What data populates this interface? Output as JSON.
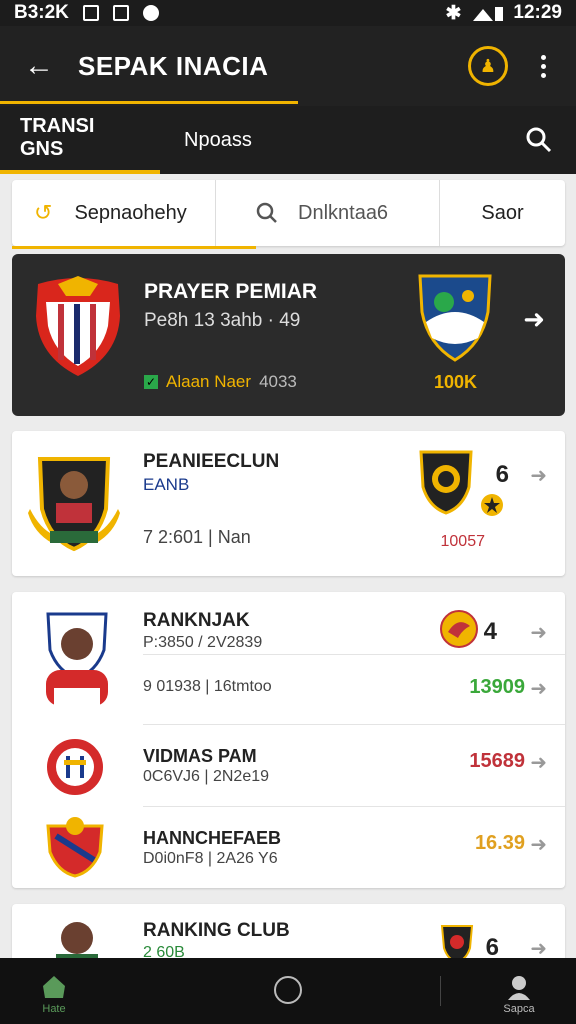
{
  "status_bar": {
    "left_text": "B3:2K",
    "time": "12:29"
  },
  "app_bar": {
    "title": "SEPAK INACIA"
  },
  "tabs": [
    {
      "label": "TRANSI GNS"
    },
    {
      "label": "Npoass"
    }
  ],
  "filters": {
    "first": "Sepnaohehy",
    "second": "Dnlkntaa6",
    "third": "Saor"
  },
  "featured": {
    "name": "PRAYER PEMIAR",
    "sub": "Pe8h 13 3ahb · 49",
    "meta_label": "Alaan Naer",
    "meta_number": "4033",
    "score": "100K"
  },
  "cards": [
    {
      "title": "PEANIEECLUN",
      "sub": "EANB",
      "meta": "7  2:601 | Nan",
      "val_top": "6",
      "val_bottom": "10057",
      "val_color": "#c0323a"
    },
    {
      "title": "RANKNJAK",
      "sub": "P:3850  / 2V2839",
      "meta": "9 01938 | 16tmtoo",
      "val_top": "4",
      "val": "13909",
      "val_color": "#3aa83a"
    },
    {
      "title": "VIDMAS PAM",
      "sub": "0C6VJ6  | 2N2e19",
      "val": "15689",
      "val_color": "#c0323a"
    },
    {
      "title": "HANNCHEFAEB",
      "sub": "D0i0nF8 | 2A26 Y6",
      "val": "16.39",
      "val_color": "#e0a020"
    }
  ],
  "last_card": {
    "title": "RANKING CLUB",
    "sub": "2 60B",
    "val": "6"
  },
  "bottom_nav": {
    "home_label": "Hate",
    "profile_label": "Sapca"
  },
  "colors": {
    "accent": "#f0b400",
    "dark": "#222222"
  }
}
